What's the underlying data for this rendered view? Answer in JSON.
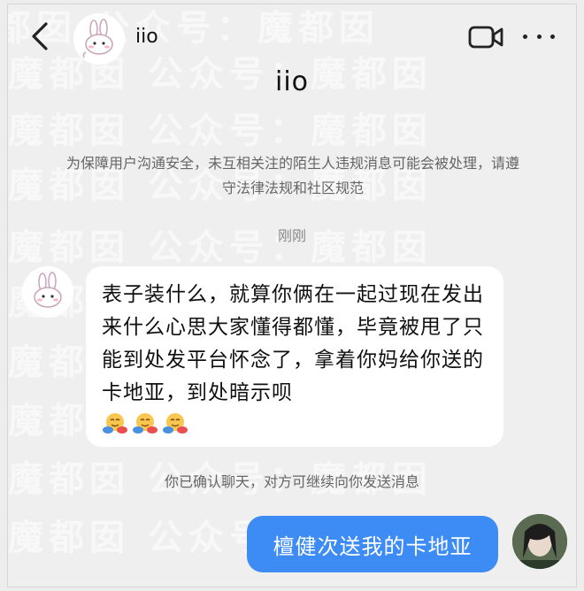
{
  "header": {
    "contact_name": "iio",
    "back_icon": "chevron-left-icon",
    "video_icon": "video-call-icon",
    "more_icon": "more-dots-icon"
  },
  "profile": {
    "name": "iio",
    "notice": "为保障用户沟通安全，未互相关注的陌生人违规消息可能会被处理，请遵守法律法规和社区规范"
  },
  "messages": [
    {
      "direction": "incoming",
      "time": "刚刚",
      "text": "表子装什么，就算你俩在一起过现在发出来什么心思大家懂得都懂，毕竟被甩了只能到处发平台怀念了，拿着你妈给你送的卡地亚，到处暗示呗",
      "emojis": [
        "hug-face",
        "hug-face",
        "hug-face"
      ]
    },
    {
      "direction": "outgoing",
      "text": "檀健次送我的卡地亚"
    }
  ],
  "system": {
    "confirm_text": "你已确认聊天，对方可继续向你发送消息"
  },
  "watermark": "魔都囡   公众号：魔都囡",
  "colors": {
    "background": "#efefef",
    "incoming_bubble": "#ffffff",
    "outgoing_bubble": "#3d8bf5"
  }
}
